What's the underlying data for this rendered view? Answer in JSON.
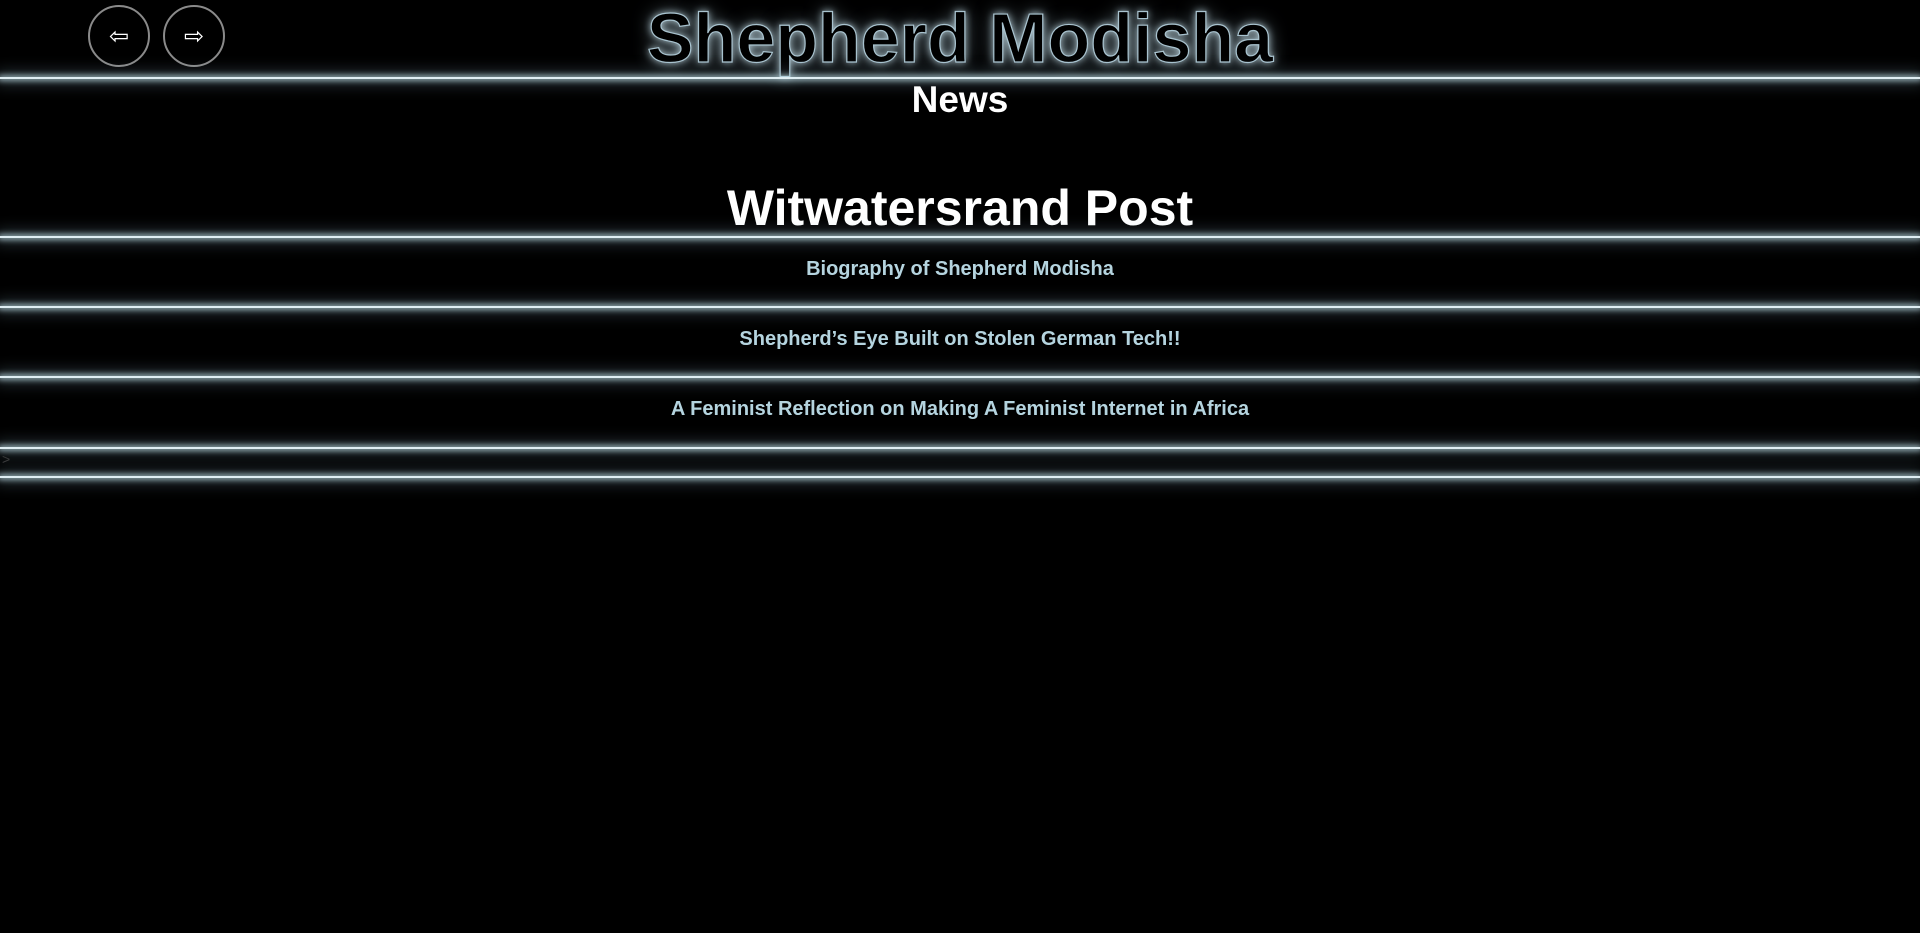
{
  "nav": {
    "back_icon": "⇦",
    "forward_icon": "⇨"
  },
  "header": {
    "site_title": "Shepherd Modisha"
  },
  "main": {
    "section_heading": "News",
    "publication_heading": "Witwatersrand Post",
    "articles": [
      {
        "title": "Biography of Shepherd Modisha"
      },
      {
        "title": "Shepherd’s Eye Built on Stolen German Tech!!"
      },
      {
        "title": "A Feminist Reflection on Making A Feminist Internet in Africa"
      }
    ],
    "stray_text": ">"
  },
  "colors": {
    "background": "#000000",
    "glow": "#dfeef3",
    "link": "#b5d4df",
    "heading": "#ffffff"
  }
}
